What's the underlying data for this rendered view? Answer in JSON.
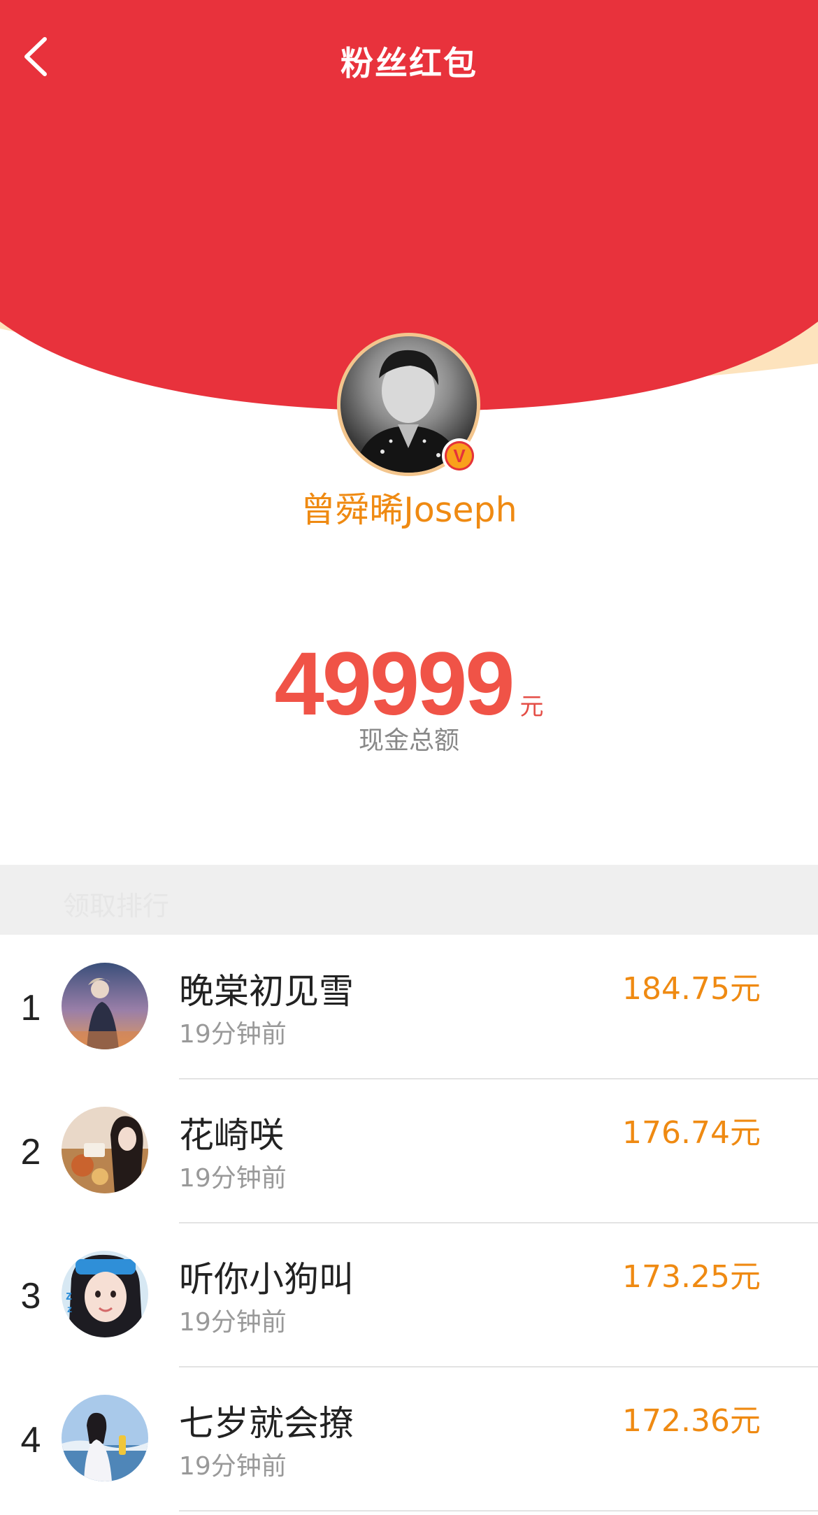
{
  "header": {
    "title": "粉丝红包",
    "back_icon": "chevron-left-icon",
    "bg_color": "#e8323c",
    "curve_rim_color": "#fde3bd"
  },
  "host": {
    "name": "曾舜晞Joseph",
    "verified_badge_text": "V",
    "badge_icon": "verified-v-icon"
  },
  "total": {
    "amount": "49999",
    "unit": "元",
    "label": "现金总额",
    "color": "#f05347"
  },
  "section": {
    "label": "领取排行"
  },
  "ranking": [
    {
      "rank": "1",
      "name": "晚棠初见雪",
      "time": "19分钟前",
      "amount": "184.75元"
    },
    {
      "rank": "2",
      "name": "花崎咲",
      "time": "19分钟前",
      "amount": "176.74元"
    },
    {
      "rank": "3",
      "name": "听你小狗叫",
      "time": "19分钟前",
      "amount": "173.25元"
    },
    {
      "rank": "4",
      "name": "七岁就会撩",
      "time": "19分钟前",
      "amount": "172.36元"
    }
  ]
}
